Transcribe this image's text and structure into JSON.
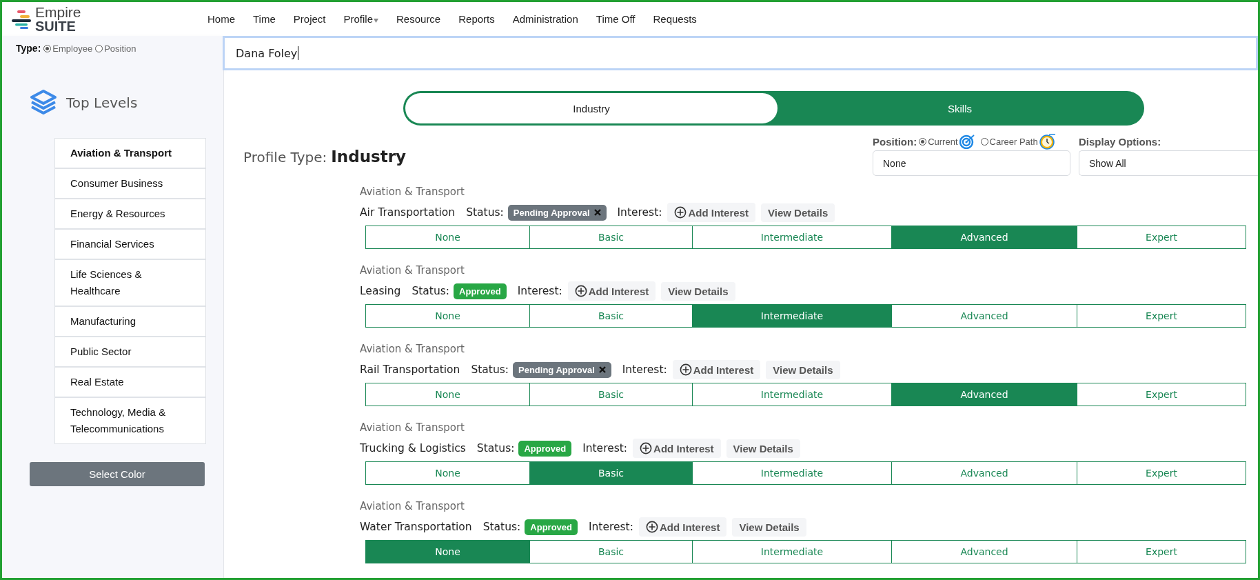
{
  "brand": {
    "line1": "Empire",
    "line2": "SUITE"
  },
  "nav": [
    {
      "label": "Home",
      "has_menu": false
    },
    {
      "label": "Time",
      "has_menu": false
    },
    {
      "label": "Project",
      "has_menu": false
    },
    {
      "label": "Profile",
      "has_menu": true
    },
    {
      "label": "Resource",
      "has_menu": false
    },
    {
      "label": "Reports",
      "has_menu": false
    },
    {
      "label": "Administration",
      "has_menu": false
    },
    {
      "label": "Time Off",
      "has_menu": false
    },
    {
      "label": "Requests",
      "has_menu": false
    }
  ],
  "type_filter": {
    "label": "Type:",
    "options": [
      {
        "label": "Employee",
        "selected": true
      },
      {
        "label": "Position",
        "selected": false
      }
    ]
  },
  "search": {
    "value": "Dana Foley"
  },
  "sidebar": {
    "title": "Top Levels",
    "items": [
      {
        "label": "Aviation & Transport",
        "selected": true
      },
      {
        "label": "Consumer Business",
        "selected": false
      },
      {
        "label": "Energy & Resources",
        "selected": false
      },
      {
        "label": "Financial Services",
        "selected": false
      },
      {
        "label": "Life Sciences & Healthcare",
        "selected": false
      },
      {
        "label": "Manufacturing",
        "selected": false
      },
      {
        "label": "Public Sector",
        "selected": false
      },
      {
        "label": "Real Estate",
        "selected": false
      },
      {
        "label": "Technology, Media & Telecommunications",
        "selected": false
      }
    ],
    "button": "Select Color"
  },
  "tabs": [
    {
      "label": "Industry",
      "selected": true
    },
    {
      "label": "Skills",
      "selected": false
    }
  ],
  "profile_type": {
    "label": "Profile Type:",
    "value": "Industry"
  },
  "position": {
    "label": "Position:",
    "options": [
      {
        "label": "Current",
        "selected": true
      },
      {
        "label": "Career Path",
        "selected": false
      }
    ],
    "value": "None"
  },
  "display_options": {
    "label": "Display Options:",
    "value": "Show All"
  },
  "skills": [
    {
      "category": "Aviation & Transport",
      "name": "Air Transportation",
      "status_label": "Status:",
      "status": {
        "label": "Pending Approval",
        "kind": "pending"
      },
      "interest_label": "Interest:",
      "add_interest": "Add Interest",
      "view_details": "View Details",
      "levels": [
        {
          "label": "None",
          "selected": false
        },
        {
          "label": "Basic",
          "selected": false
        },
        {
          "label": "Intermediate",
          "selected": false
        },
        {
          "label": "Advanced",
          "selected": true
        },
        {
          "label": "Expert",
          "selected": false
        }
      ]
    },
    {
      "category": "Aviation & Transport",
      "name": "Leasing",
      "status_label": "Status:",
      "status": {
        "label": "Approved",
        "kind": "approved"
      },
      "interest_label": "Interest:",
      "add_interest": "Add Interest",
      "view_details": "View Details",
      "levels": [
        {
          "label": "None",
          "selected": false
        },
        {
          "label": "Basic",
          "selected": false
        },
        {
          "label": "Intermediate",
          "selected": true
        },
        {
          "label": "Advanced",
          "selected": false
        },
        {
          "label": "Expert",
          "selected": false
        }
      ]
    },
    {
      "category": "Aviation & Transport",
      "name": "Rail Transportation",
      "status_label": "Status:",
      "status": {
        "label": "Pending Approval",
        "kind": "pending"
      },
      "interest_label": "Interest:",
      "add_interest": "Add Interest",
      "view_details": "View Details",
      "levels": [
        {
          "label": "None",
          "selected": false
        },
        {
          "label": "Basic",
          "selected": false
        },
        {
          "label": "Intermediate",
          "selected": false
        },
        {
          "label": "Advanced",
          "selected": true
        },
        {
          "label": "Expert",
          "selected": false
        }
      ]
    },
    {
      "category": "Aviation & Transport",
      "name": "Trucking & Logistics",
      "status_label": "Status:",
      "status": {
        "label": "Approved",
        "kind": "approved"
      },
      "interest_label": "Interest:",
      "add_interest": "Add Interest",
      "view_details": "View Details",
      "levels": [
        {
          "label": "None",
          "selected": false
        },
        {
          "label": "Basic",
          "selected": true
        },
        {
          "label": "Intermediate",
          "selected": false
        },
        {
          "label": "Advanced",
          "selected": false
        },
        {
          "label": "Expert",
          "selected": false
        }
      ]
    },
    {
      "category": "Aviation & Transport",
      "name": "Water Transportation",
      "status_label": "Status:",
      "status": {
        "label": "Approved",
        "kind": "approved"
      },
      "interest_label": "Interest:",
      "add_interest": "Add Interest",
      "view_details": "View Details",
      "levels": [
        {
          "label": "None",
          "selected": true
        },
        {
          "label": "Basic",
          "selected": false
        },
        {
          "label": "Intermediate",
          "selected": false
        },
        {
          "label": "Advanced",
          "selected": false
        },
        {
          "label": "Expert",
          "selected": false
        }
      ]
    }
  ]
}
